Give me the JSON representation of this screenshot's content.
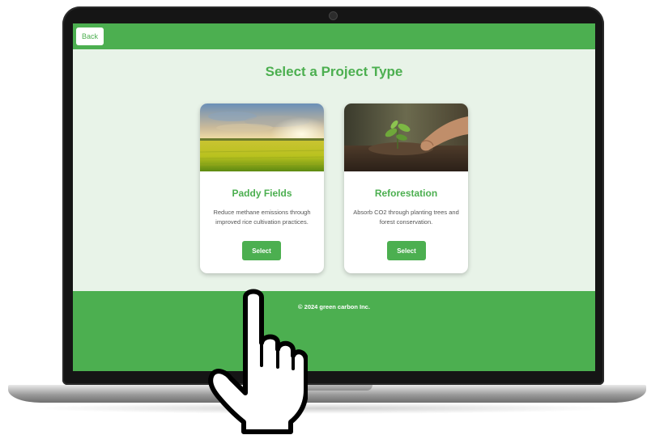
{
  "header": {
    "back_label": "Back"
  },
  "page": {
    "title": "Select a Project Type"
  },
  "projects": [
    {
      "title": "Paddy Fields",
      "description": "Reduce methane emissions through improved rice cultivation practices.",
      "select_label": "Select",
      "image_icon": "rice-field-photo"
    },
    {
      "title": "Reforestation",
      "description": "Absorb CO2 through planting trees and forest conservation.",
      "select_label": "Select",
      "image_icon": "tree-planting-photo"
    }
  ],
  "footer": {
    "text": "© 2024 green carbon Inc."
  },
  "cursor": {
    "icon": "pointing-hand-icon"
  },
  "colors": {
    "accent": "#4caf50",
    "background": "#e8f3e8",
    "card": "#ffffff"
  }
}
